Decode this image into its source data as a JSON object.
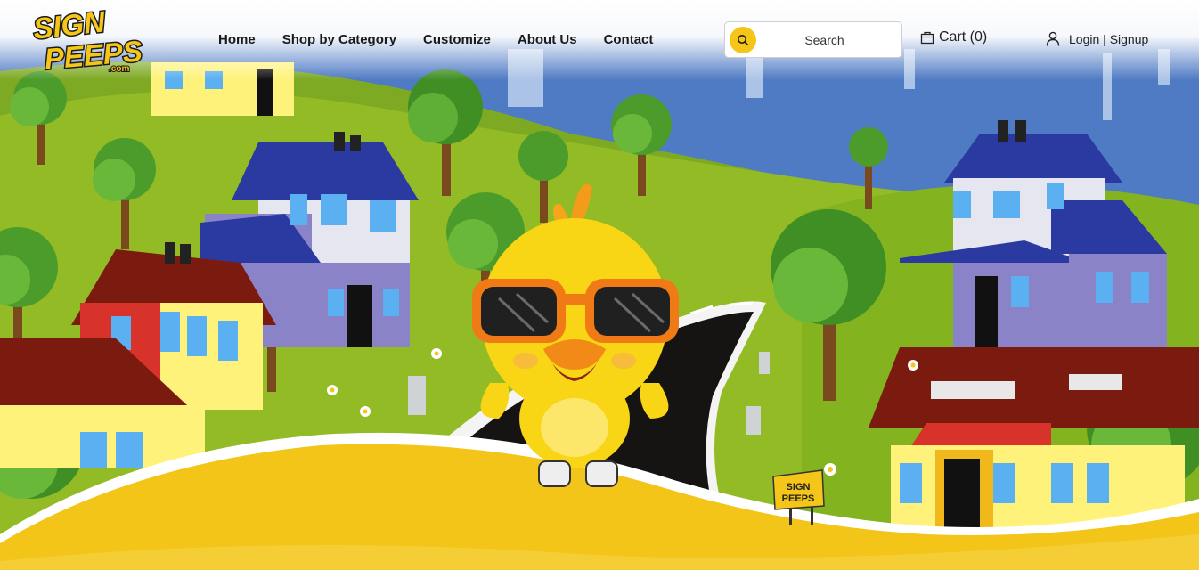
{
  "brand": {
    "logo_line1": "SIGN",
    "logo_line2": "PEEPS",
    "logo_suffix": ".com",
    "yard_sign_line1": "SIGN",
    "yard_sign_line2": "PEEPS"
  },
  "nav": {
    "items": [
      "Home",
      "Shop by Category",
      "Customize",
      "About Us",
      "Contact"
    ]
  },
  "search": {
    "placeholder": "Search"
  },
  "cart": {
    "label": "Cart (0)"
  },
  "account": {
    "login": "Login",
    "separator": "|",
    "signup": "Signup"
  },
  "colors": {
    "accent": "#f5c518",
    "sky": "#3f6fbf",
    "grass": "#8fbf2a",
    "banner": "#f3c518"
  },
  "icons": [
    "search-icon",
    "cart-icon",
    "user-icon"
  ]
}
